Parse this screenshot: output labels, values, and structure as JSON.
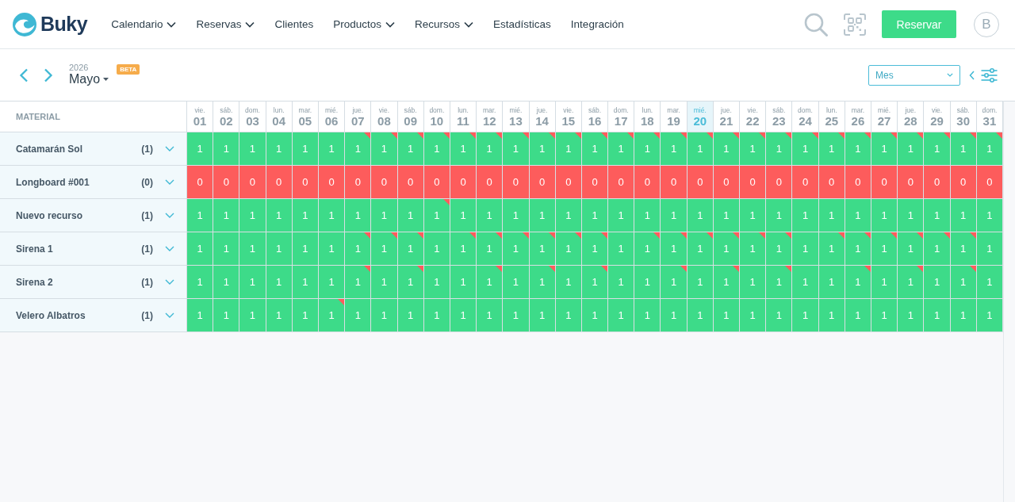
{
  "nav": {
    "logo": "Buky",
    "items": [
      {
        "label": "Calendario",
        "dropdown": true
      },
      {
        "label": "Reservas",
        "dropdown": true
      },
      {
        "label": "Clientes",
        "dropdown": false
      },
      {
        "label": "Productos",
        "dropdown": true
      },
      {
        "label": "Recursos",
        "dropdown": true
      },
      {
        "label": "Estadísticas",
        "dropdown": false
      },
      {
        "label": "Integración",
        "dropdown": false
      }
    ],
    "action_button": "Reservar",
    "avatar": "B"
  },
  "toolbar": {
    "year": "2026",
    "month": "Mayo",
    "badge": "BETA",
    "view_select": {
      "value": "Mes"
    }
  },
  "calendar": {
    "resource_header": "MATERIAL",
    "days": [
      {
        "weekday": "vie.",
        "day": "01",
        "today": false
      },
      {
        "weekday": "sáb.",
        "day": "02",
        "today": false
      },
      {
        "weekday": "dom.",
        "day": "03",
        "today": false
      },
      {
        "weekday": "lun.",
        "day": "04",
        "today": false
      },
      {
        "weekday": "mar.",
        "day": "05",
        "today": false
      },
      {
        "weekday": "mié.",
        "day": "06",
        "today": false
      },
      {
        "weekday": "jue.",
        "day": "07",
        "today": false
      },
      {
        "weekday": "vie.",
        "day": "08",
        "today": false
      },
      {
        "weekday": "sáb.",
        "day": "09",
        "today": false
      },
      {
        "weekday": "dom.",
        "day": "10",
        "today": false
      },
      {
        "weekday": "lun.",
        "day": "11",
        "today": false
      },
      {
        "weekday": "mar.",
        "day": "12",
        "today": false
      },
      {
        "weekday": "mié.",
        "day": "13",
        "today": false
      },
      {
        "weekday": "jue.",
        "day": "14",
        "today": false
      },
      {
        "weekday": "vie.",
        "day": "15",
        "today": false
      },
      {
        "weekday": "sáb.",
        "day": "16",
        "today": false
      },
      {
        "weekday": "dom.",
        "day": "17",
        "today": false
      },
      {
        "weekday": "lun.",
        "day": "18",
        "today": false
      },
      {
        "weekday": "mar.",
        "day": "19",
        "today": false
      },
      {
        "weekday": "mié.",
        "day": "20",
        "today": true
      },
      {
        "weekday": "jue.",
        "day": "21",
        "today": false
      },
      {
        "weekday": "vie.",
        "day": "22",
        "today": false
      },
      {
        "weekday": "sáb.",
        "day": "23",
        "today": false
      },
      {
        "weekday": "dom.",
        "day": "24",
        "today": false
      },
      {
        "weekday": "lun.",
        "day": "25",
        "today": false
      },
      {
        "weekday": "mar.",
        "day": "26",
        "today": false
      },
      {
        "weekday": "mié.",
        "day": "27",
        "today": false
      },
      {
        "weekday": "jue.",
        "day": "28",
        "today": false
      },
      {
        "weekday": "vie.",
        "day": "29",
        "today": false
      },
      {
        "weekday": "sáb.",
        "day": "30",
        "today": false
      },
      {
        "weekday": "dom.",
        "day": "31",
        "today": false
      }
    ],
    "resources": [
      {
        "name": "Catamarán Sol",
        "count": "(1)",
        "cells": [
          {
            "value": "1",
            "available": true,
            "flagged": false
          },
          {
            "value": "1",
            "available": true,
            "flagged": false
          },
          {
            "value": "1",
            "available": true,
            "flagged": false
          },
          {
            "value": "1",
            "available": true,
            "flagged": false
          },
          {
            "value": "1",
            "available": true,
            "flagged": false
          },
          {
            "value": "1",
            "available": true,
            "flagged": false
          },
          {
            "value": "1",
            "available": true,
            "flagged": true
          },
          {
            "value": "1",
            "available": true,
            "flagged": true
          },
          {
            "value": "1",
            "available": true,
            "flagged": true
          },
          {
            "value": "1",
            "available": true,
            "flagged": true
          },
          {
            "value": "1",
            "available": true,
            "flagged": true
          },
          {
            "value": "1",
            "available": true,
            "flagged": true
          },
          {
            "value": "1",
            "available": true,
            "flagged": true
          },
          {
            "value": "1",
            "available": true,
            "flagged": true
          },
          {
            "value": "1",
            "available": true,
            "flagged": true
          },
          {
            "value": "1",
            "available": true,
            "flagged": true
          },
          {
            "value": "1",
            "available": true,
            "flagged": true
          },
          {
            "value": "1",
            "available": true,
            "flagged": true
          },
          {
            "value": "1",
            "available": true,
            "flagged": true
          },
          {
            "value": "1",
            "available": true,
            "flagged": true
          },
          {
            "value": "1",
            "available": true,
            "flagged": true
          },
          {
            "value": "1",
            "available": true,
            "flagged": true
          },
          {
            "value": "1",
            "available": true,
            "flagged": true
          },
          {
            "value": "1",
            "available": true,
            "flagged": true
          },
          {
            "value": "1",
            "available": true,
            "flagged": true
          },
          {
            "value": "1",
            "available": true,
            "flagged": true
          },
          {
            "value": "1",
            "available": true,
            "flagged": true
          },
          {
            "value": "1",
            "available": true,
            "flagged": true
          },
          {
            "value": "1",
            "available": true,
            "flagged": true
          },
          {
            "value": "1",
            "available": true,
            "flagged": true
          },
          {
            "value": "1",
            "available": true,
            "flagged": true
          }
        ]
      },
      {
        "name": "Longboard #001",
        "count": "(0)",
        "cells": [
          {
            "value": "0",
            "available": false,
            "flagged": false
          },
          {
            "value": "0",
            "available": false,
            "flagged": false
          },
          {
            "value": "0",
            "available": false,
            "flagged": false
          },
          {
            "value": "0",
            "available": false,
            "flagged": false
          },
          {
            "value": "0",
            "available": false,
            "flagged": false
          },
          {
            "value": "0",
            "available": false,
            "flagged": false
          },
          {
            "value": "0",
            "available": false,
            "flagged": false
          },
          {
            "value": "0",
            "available": false,
            "flagged": false
          },
          {
            "value": "0",
            "available": false,
            "flagged": false
          },
          {
            "value": "0",
            "available": false,
            "flagged": false
          },
          {
            "value": "0",
            "available": false,
            "flagged": false
          },
          {
            "value": "0",
            "available": false,
            "flagged": false
          },
          {
            "value": "0",
            "available": false,
            "flagged": false
          },
          {
            "value": "0",
            "available": false,
            "flagged": false
          },
          {
            "value": "0",
            "available": false,
            "flagged": false
          },
          {
            "value": "0",
            "available": false,
            "flagged": false
          },
          {
            "value": "0",
            "available": false,
            "flagged": false
          },
          {
            "value": "0",
            "available": false,
            "flagged": false
          },
          {
            "value": "0",
            "available": false,
            "flagged": false
          },
          {
            "value": "0",
            "available": false,
            "flagged": false
          },
          {
            "value": "0",
            "available": false,
            "flagged": false
          },
          {
            "value": "0",
            "available": false,
            "flagged": false
          },
          {
            "value": "0",
            "available": false,
            "flagged": false
          },
          {
            "value": "0",
            "available": false,
            "flagged": false
          },
          {
            "value": "0",
            "available": false,
            "flagged": false
          },
          {
            "value": "0",
            "available": false,
            "flagged": false
          },
          {
            "value": "0",
            "available": false,
            "flagged": false
          },
          {
            "value": "0",
            "available": false,
            "flagged": false
          },
          {
            "value": "0",
            "available": false,
            "flagged": false
          },
          {
            "value": "0",
            "available": false,
            "flagged": false
          },
          {
            "value": "0",
            "available": false,
            "flagged": false
          }
        ]
      },
      {
        "name": "Nuevo recurso",
        "count": "(1)",
        "cells": [
          {
            "value": "1",
            "available": true,
            "flagged": false
          },
          {
            "value": "1",
            "available": true,
            "flagged": false
          },
          {
            "value": "1",
            "available": true,
            "flagged": false
          },
          {
            "value": "1",
            "available": true,
            "flagged": false
          },
          {
            "value": "1",
            "available": true,
            "flagged": false
          },
          {
            "value": "1",
            "available": true,
            "flagged": false
          },
          {
            "value": "1",
            "available": true,
            "flagged": false
          },
          {
            "value": "1",
            "available": true,
            "flagged": false
          },
          {
            "value": "1",
            "available": true,
            "flagged": false
          },
          {
            "value": "1",
            "available": true,
            "flagged": true
          },
          {
            "value": "1",
            "available": true,
            "flagged": false
          },
          {
            "value": "1",
            "available": true,
            "flagged": false
          },
          {
            "value": "1",
            "available": true,
            "flagged": false
          },
          {
            "value": "1",
            "available": true,
            "flagged": false
          },
          {
            "value": "1",
            "available": true,
            "flagged": false
          },
          {
            "value": "1",
            "available": true,
            "flagged": false
          },
          {
            "value": "1",
            "available": true,
            "flagged": false
          },
          {
            "value": "1",
            "available": true,
            "flagged": false
          },
          {
            "value": "1",
            "available": true,
            "flagged": false
          },
          {
            "value": "1",
            "available": true,
            "flagged": false
          },
          {
            "value": "1",
            "available": true,
            "flagged": false
          },
          {
            "value": "1",
            "available": true,
            "flagged": false
          },
          {
            "value": "1",
            "available": true,
            "flagged": false
          },
          {
            "value": "1",
            "available": true,
            "flagged": false
          },
          {
            "value": "1",
            "available": true,
            "flagged": false
          },
          {
            "value": "1",
            "available": true,
            "flagged": false
          },
          {
            "value": "1",
            "available": true,
            "flagged": false
          },
          {
            "value": "1",
            "available": true,
            "flagged": false
          },
          {
            "value": "1",
            "available": true,
            "flagged": false
          },
          {
            "value": "1",
            "available": true,
            "flagged": false
          },
          {
            "value": "1",
            "available": true,
            "flagged": false
          }
        ]
      },
      {
        "name": "Sirena 1",
        "count": "(1)",
        "cells": [
          {
            "value": "1",
            "available": true,
            "flagged": false
          },
          {
            "value": "1",
            "available": true,
            "flagged": false
          },
          {
            "value": "1",
            "available": true,
            "flagged": false
          },
          {
            "value": "1",
            "available": true,
            "flagged": false
          },
          {
            "value": "1",
            "available": true,
            "flagged": false
          },
          {
            "value": "1",
            "available": true,
            "flagged": false
          },
          {
            "value": "1",
            "available": true,
            "flagged": true
          },
          {
            "value": "1",
            "available": true,
            "flagged": true
          },
          {
            "value": "1",
            "available": true,
            "flagged": true
          },
          {
            "value": "1",
            "available": true,
            "flagged": false
          },
          {
            "value": "1",
            "available": true,
            "flagged": true
          },
          {
            "value": "1",
            "available": true,
            "flagged": true
          },
          {
            "value": "1",
            "available": true,
            "flagged": true
          },
          {
            "value": "1",
            "available": true,
            "flagged": true
          },
          {
            "value": "1",
            "available": true,
            "flagged": true
          },
          {
            "value": "1",
            "available": true,
            "flagged": true
          },
          {
            "value": "1",
            "available": true,
            "flagged": false
          },
          {
            "value": "1",
            "available": true,
            "flagged": true
          },
          {
            "value": "1",
            "available": true,
            "flagged": true
          },
          {
            "value": "1",
            "available": true,
            "flagged": true
          },
          {
            "value": "1",
            "available": true,
            "flagged": true
          },
          {
            "value": "1",
            "available": true,
            "flagged": true
          },
          {
            "value": "1",
            "available": true,
            "flagged": true
          },
          {
            "value": "1",
            "available": true,
            "flagged": false
          },
          {
            "value": "1",
            "available": true,
            "flagged": true
          },
          {
            "value": "1",
            "available": true,
            "flagged": true
          },
          {
            "value": "1",
            "available": true,
            "flagged": true
          },
          {
            "value": "1",
            "available": true,
            "flagged": true
          },
          {
            "value": "1",
            "available": true,
            "flagged": true
          },
          {
            "value": "1",
            "available": true,
            "flagged": true
          },
          {
            "value": "1",
            "available": true,
            "flagged": false
          }
        ]
      },
      {
        "name": "Sirena 2",
        "count": "(1)",
        "cells": [
          {
            "value": "1",
            "available": true,
            "flagged": false
          },
          {
            "value": "1",
            "available": true,
            "flagged": false
          },
          {
            "value": "1",
            "available": true,
            "flagged": false
          },
          {
            "value": "1",
            "available": true,
            "flagged": false
          },
          {
            "value": "1",
            "available": true,
            "flagged": false
          },
          {
            "value": "1",
            "available": true,
            "flagged": false
          },
          {
            "value": "1",
            "available": true,
            "flagged": true
          },
          {
            "value": "1",
            "available": true,
            "flagged": false
          },
          {
            "value": "1",
            "available": true,
            "flagged": true
          },
          {
            "value": "1",
            "available": true,
            "flagged": false
          },
          {
            "value": "1",
            "available": true,
            "flagged": false
          },
          {
            "value": "1",
            "available": true,
            "flagged": true
          },
          {
            "value": "1",
            "available": true,
            "flagged": false
          },
          {
            "value": "1",
            "available": true,
            "flagged": true
          },
          {
            "value": "1",
            "available": true,
            "flagged": false
          },
          {
            "value": "1",
            "available": true,
            "flagged": true
          },
          {
            "value": "1",
            "available": true,
            "flagged": false
          },
          {
            "value": "1",
            "available": true,
            "flagged": false
          },
          {
            "value": "1",
            "available": true,
            "flagged": true
          },
          {
            "value": "1",
            "available": true,
            "flagged": false
          },
          {
            "value": "1",
            "available": true,
            "flagged": true
          },
          {
            "value": "1",
            "available": true,
            "flagged": false
          },
          {
            "value": "1",
            "available": true,
            "flagged": true
          },
          {
            "value": "1",
            "available": true,
            "flagged": false
          },
          {
            "value": "1",
            "available": true,
            "flagged": false
          },
          {
            "value": "1",
            "available": true,
            "flagged": true
          },
          {
            "value": "1",
            "available": true,
            "flagged": false
          },
          {
            "value": "1",
            "available": true,
            "flagged": true
          },
          {
            "value": "1",
            "available": true,
            "flagged": false
          },
          {
            "value": "1",
            "available": true,
            "flagged": true
          },
          {
            "value": "1",
            "available": true,
            "flagged": false
          }
        ]
      },
      {
        "name": "Velero Albatros",
        "count": "(1)",
        "cells": [
          {
            "value": "1",
            "available": true,
            "flagged": false
          },
          {
            "value": "1",
            "available": true,
            "flagged": false
          },
          {
            "value": "1",
            "available": true,
            "flagged": false
          },
          {
            "value": "1",
            "available": true,
            "flagged": false
          },
          {
            "value": "1",
            "available": true,
            "flagged": false
          },
          {
            "value": "1",
            "available": true,
            "flagged": true
          },
          {
            "value": "1",
            "available": true,
            "flagged": false
          },
          {
            "value": "1",
            "available": true,
            "flagged": false
          },
          {
            "value": "1",
            "available": true,
            "flagged": false
          },
          {
            "value": "1",
            "available": true,
            "flagged": false
          },
          {
            "value": "1",
            "available": true,
            "flagged": false
          },
          {
            "value": "1",
            "available": true,
            "flagged": false
          },
          {
            "value": "1",
            "available": true,
            "flagged": false
          },
          {
            "value": "1",
            "available": true,
            "flagged": false
          },
          {
            "value": "1",
            "available": true,
            "flagged": false
          },
          {
            "value": "1",
            "available": true,
            "flagged": false
          },
          {
            "value": "1",
            "available": true,
            "flagged": false
          },
          {
            "value": "1",
            "available": true,
            "flagged": false
          },
          {
            "value": "1",
            "available": true,
            "flagged": false
          },
          {
            "value": "1",
            "available": true,
            "flagged": false
          },
          {
            "value": "1",
            "available": true,
            "flagged": false
          },
          {
            "value": "1",
            "available": true,
            "flagged": false
          },
          {
            "value": "1",
            "available": true,
            "flagged": false
          },
          {
            "value": "1",
            "available": true,
            "flagged": false
          },
          {
            "value": "1",
            "available": true,
            "flagged": false
          },
          {
            "value": "1",
            "available": true,
            "flagged": false
          },
          {
            "value": "1",
            "available": true,
            "flagged": false
          },
          {
            "value": "1",
            "available": true,
            "flagged": false
          },
          {
            "value": "1",
            "available": true,
            "flagged": false
          },
          {
            "value": "1",
            "available": true,
            "flagged": false
          },
          {
            "value": "1",
            "available": true,
            "flagged": false
          }
        ]
      }
    ]
  }
}
